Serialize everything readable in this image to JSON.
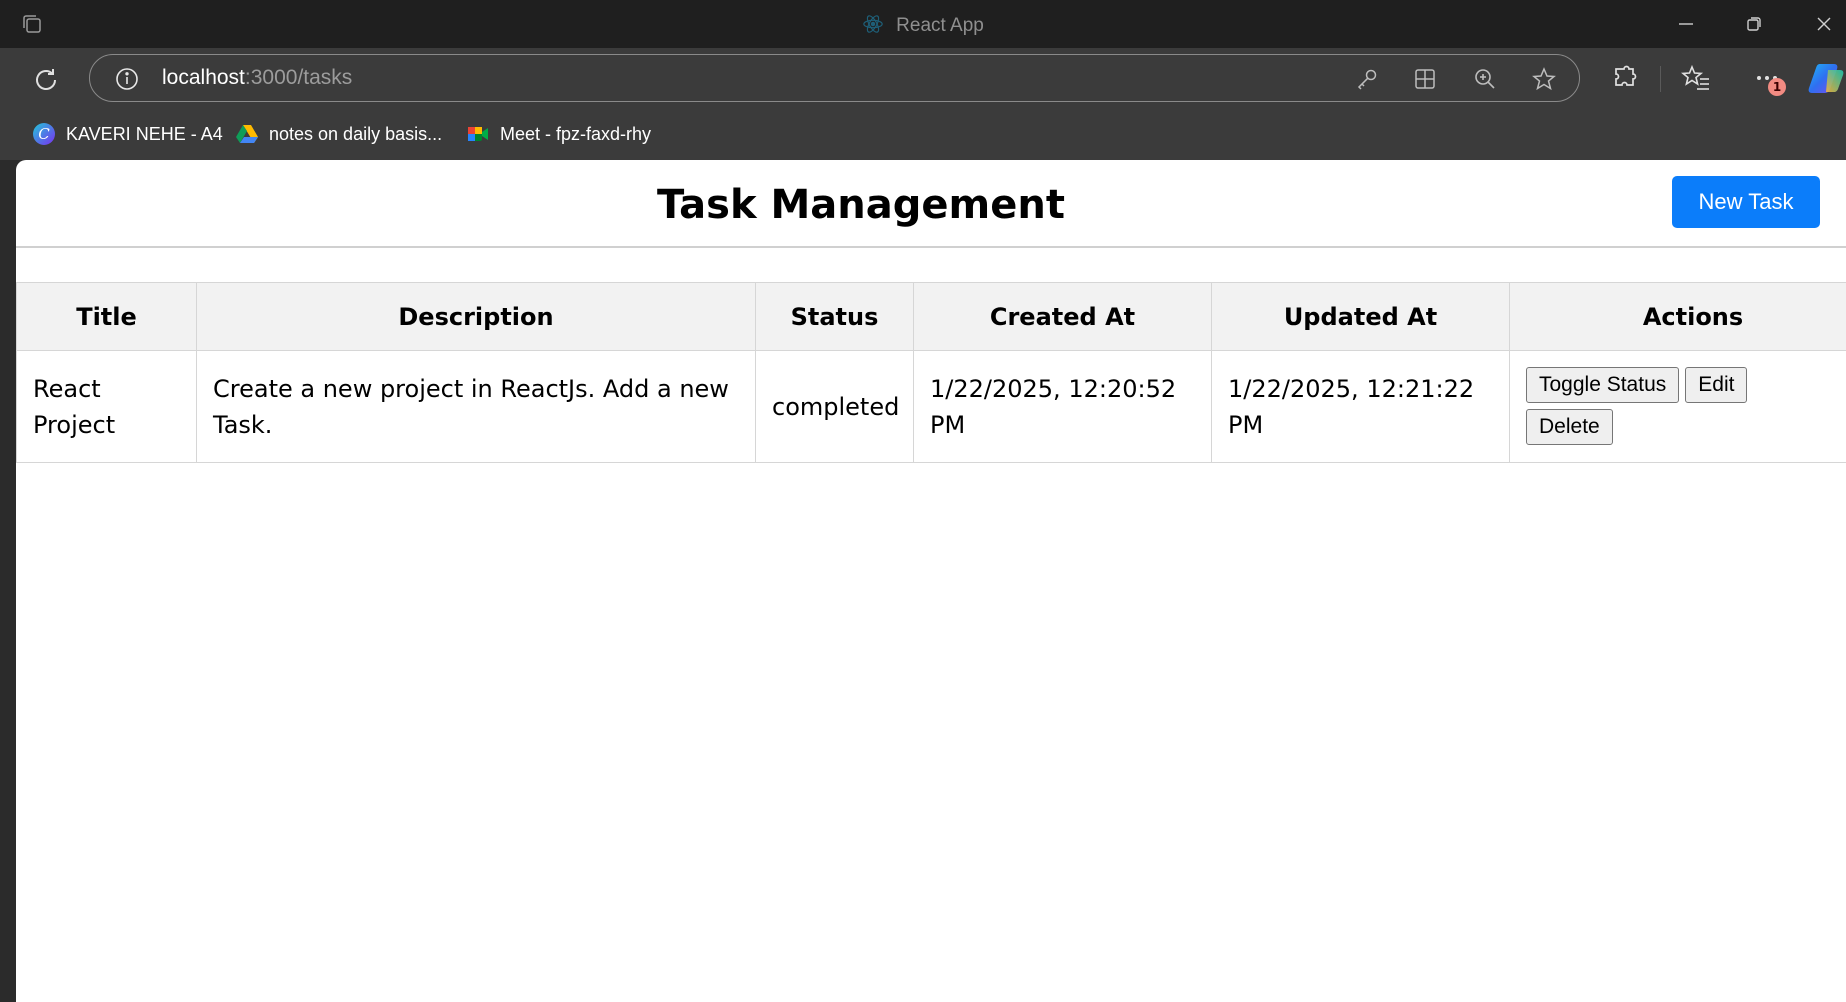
{
  "window": {
    "title": "React App"
  },
  "browser": {
    "url_host": "localhost",
    "url_path": ":3000/tasks",
    "notification_count": "1"
  },
  "bookmarks": [
    {
      "label": "KAVERI NEHE - A4",
      "icon": "canva-icon"
    },
    {
      "label": "notes on daily basis...",
      "icon": "google-drive-icon"
    },
    {
      "label": "Meet - fpz-faxd-rhy",
      "icon": "google-meet-icon"
    }
  ],
  "app": {
    "title": "Task Management",
    "new_task_label": "New Task",
    "accent_color": "#0b7dfa"
  },
  "table": {
    "headers": [
      "Title",
      "Description",
      "Status",
      "Created At",
      "Updated At",
      "Actions"
    ],
    "rows": [
      {
        "title": "React Project",
        "description": "Create a new project in ReactJs. Add a new Task.",
        "status": "completed",
        "created_at": "1/22/2025, 12:20:52 PM",
        "updated_at": "1/22/2025, 12:21:22 PM",
        "actions": {
          "toggle": "Toggle Status",
          "edit": "Edit",
          "delete": "Delete"
        }
      }
    ]
  }
}
